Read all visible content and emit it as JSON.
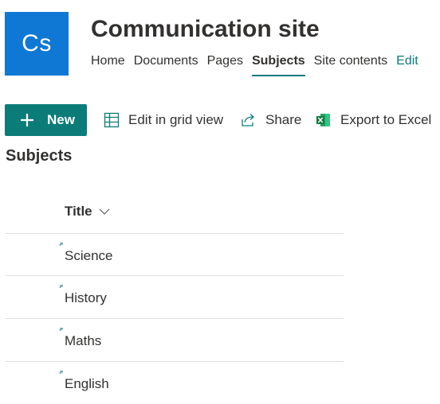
{
  "site": {
    "logo_initials": "Cs",
    "logo_color": "#0f78d4",
    "title": "Communication site"
  },
  "nav": {
    "items": [
      {
        "label": "Home"
      },
      {
        "label": "Documents"
      },
      {
        "label": "Pages"
      },
      {
        "label": "Subjects",
        "active": true
      },
      {
        "label": "Site contents"
      },
      {
        "label": "Edit"
      }
    ]
  },
  "theme": {
    "accent": "#0c7c79",
    "divider": "#e1dfdd"
  },
  "commands": {
    "new_label": "New",
    "grid_label": "Edit in grid view",
    "share_label": "Share",
    "export_label": "Export to Excel",
    "icons": [
      "plus-icon",
      "grid-icon",
      "share-icon",
      "excel-icon"
    ]
  },
  "list": {
    "title": "Subjects",
    "column_header": "Title",
    "rows": [
      {
        "title": "Science"
      },
      {
        "title": "History"
      },
      {
        "title": "Maths"
      },
      {
        "title": "English"
      }
    ]
  }
}
